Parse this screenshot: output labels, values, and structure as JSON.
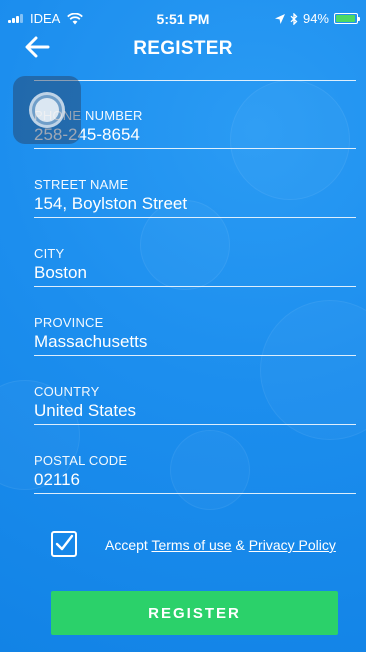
{
  "status_bar": {
    "carrier": "IDEA",
    "time": "5:51 PM",
    "battery": "94%",
    "battery_level": 0.94
  },
  "header": {
    "title": "REGISTER"
  },
  "fields": [
    {
      "label": "PHONE NUMBER",
      "value": "258-245-8654"
    },
    {
      "label": "STREET NAME",
      "value": "154, Boylston Street"
    },
    {
      "label": "CITY",
      "value": "Boston"
    },
    {
      "label": "PROVINCE",
      "value": "Massachusetts"
    },
    {
      "label": "COUNTRY",
      "value": "United States"
    },
    {
      "label": "POSTAL CODE",
      "value": "02116"
    }
  ],
  "terms": {
    "accept": "Accept",
    "terms_link": "Terms of use",
    "and": "&",
    "privacy_link": "Privacy Policy",
    "checked": true
  },
  "register_button": "REGISTER",
  "colors": {
    "background": "#1a8ef0",
    "button": "#2bd16a",
    "battery": "#4cd964"
  }
}
